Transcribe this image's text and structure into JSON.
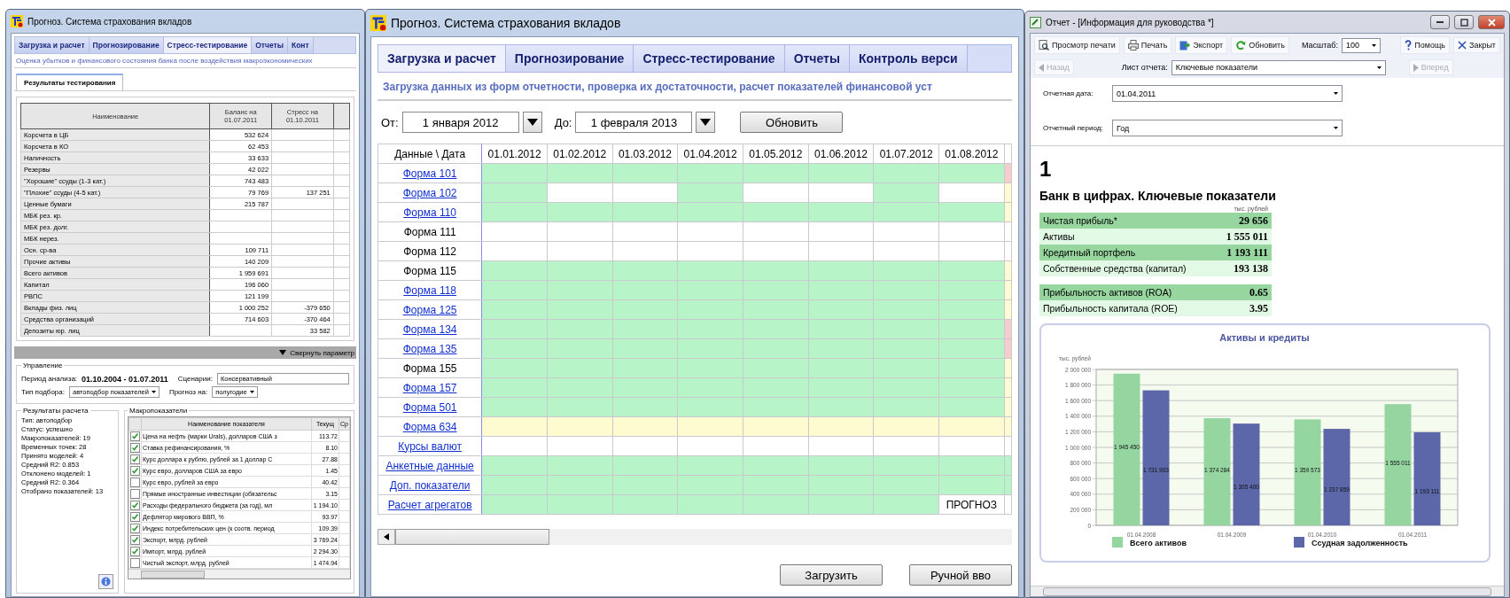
{
  "left_window": {
    "title": "Прогноз. Система страхования вкладов",
    "tabs": [
      {
        "label": "Загрузка и расчет",
        "selected": false
      },
      {
        "label": "Прогнозирование",
        "selected": false
      },
      {
        "label": "Стресс-тестирование",
        "selected": true
      },
      {
        "label": "Отчеты",
        "selected": false
      },
      {
        "label": "Конт",
        "selected": false
      }
    ],
    "subtitle": "Оценка убытков и финансового состояния банка после воздействия макроэкономических",
    "subtab": "Результаты тестирования",
    "table": {
      "columns": [
        "Наименование",
        "Баланс на 01.07.2011",
        "Стресс на 01.10.2011"
      ],
      "rows": [
        {
          "name": "Корсчета в ЦБ",
          "balance": "532 624"
        },
        {
          "name": "Корсчета в КО",
          "balance": "62 453"
        },
        {
          "name": "Наличность",
          "balance": "33 633"
        },
        {
          "name": "Резервы",
          "balance": "42 022"
        },
        {
          "name": "\"Хорошие\" ссуды (1-3 кат.)",
          "balance": "743 483"
        },
        {
          "name": "\"Плохие\" ссуды (4-5 кат.)",
          "balance": "79 769",
          "stress": "137 251"
        },
        {
          "name": "Ценные бумаги",
          "balance": "215 787"
        },
        {
          "name": "МБК рез. кр."
        },
        {
          "name": "МБК рез. долг."
        },
        {
          "name": "МБК нерез."
        },
        {
          "name": "Осн. ср-ва",
          "balance": "109 711"
        },
        {
          "name": "Прочие активы",
          "balance": "140 209"
        },
        {
          "name": "Всего активов",
          "balance": "1 959 691"
        },
        {
          "name": "Капитал",
          "balance": "196 060"
        },
        {
          "name": "РВПС",
          "balance": "121 199"
        },
        {
          "name": "Вклады физ. лиц",
          "balance": "1 000 252",
          "stress": "-379 650"
        },
        {
          "name": "Средства организаций",
          "balance": "714 603",
          "stress": "-370 464"
        },
        {
          "name": "Депозиты юр. лиц",
          "stress": "33 582"
        }
      ]
    },
    "collapse_label": "Свернуть параметр",
    "control": {
      "legend": "Управление",
      "period_label": "Период анализа:",
      "period_value": "01.10.2004 - 01.07.2011",
      "scenario_label": "Сценарии:",
      "scenario_value": "Консервативный",
      "selection_label": "Тип подбора:",
      "selection_value": "автоподбор показателей",
      "forecast_label": "Прогноз на:",
      "forecast_value": "полугодие"
    },
    "results": {
      "legend": "Результаты расчета",
      "lines": [
        "Тип: автоподбор",
        "Статус: успешно",
        "Макропоказателей: 19",
        "Временных точек: 28",
        "Принято моделей: 4",
        "Средний R2: 0.853",
        "Отклонено моделей: 1",
        "Средний R2: 0.364",
        "Отобрано показателей: 13"
      ]
    },
    "macro": {
      "legend": "Макропоказатели",
      "columns": [
        "Наименование показателя",
        "Текущ",
        "Ср"
      ],
      "rows": [
        {
          "name": "Цена на нефть (марки Urals), долларов США з",
          "checked": true,
          "current": "113.72"
        },
        {
          "name": "Ставка рефинансирования, %",
          "checked": true,
          "current": "8.10"
        },
        {
          "name": "Курс доллара к рублю, рублей за 1 доллар С",
          "checked": true,
          "current": "27.88"
        },
        {
          "name": "Курс евро, долларов США за евро",
          "checked": true,
          "current": "1.45"
        },
        {
          "name": "Курс евро, рублей за евро",
          "checked": false,
          "current": "40.42"
        },
        {
          "name": "Прямые иностранные инвестиции (обязательс",
          "checked": false,
          "current": "3.15"
        },
        {
          "name": "Расходы федерального бюджета (за год), мл",
          "checked": true,
          "current": "1 194.10"
        },
        {
          "name": "Дефлятор мирового ВВП, %",
          "checked": true,
          "current": "93.97"
        },
        {
          "name": "Индекс потребительских цен (к соотв. период",
          "checked": true,
          "current": "109.39"
        },
        {
          "name": "Экспорт, млрд. рублей",
          "checked": true,
          "current": "3 769.24"
        },
        {
          "name": "Импорт, млрд. рублей",
          "checked": true,
          "current": "2 294.30"
        },
        {
          "name": "Чистый экспорт, млрд. рублей",
          "checked": false,
          "current": "1 474.94"
        }
      ]
    }
  },
  "main_window": {
    "title": "Прогноз. Система страхования вкладов",
    "tabs": [
      {
        "label": "Загрузка и расчет",
        "selected": true
      },
      {
        "label": "Прогнозирование",
        "selected": false
      },
      {
        "label": "Стресс-тестирование",
        "selected": false
      },
      {
        "label": "Отчеты",
        "selected": false
      },
      {
        "label": "Контроль верси",
        "selected": false
      }
    ],
    "subtitle": "Загрузка данных из форм отчетности, проверка их достаточности, расчет показателей финансовой уст",
    "from_label": "От:",
    "from_value": "1 января 2012",
    "to_label": "До:",
    "to_value": "1 февраля 2013",
    "refresh_button": "Обновить",
    "grid": {
      "corner": "Данные \\ Дата",
      "dates": [
        "01.01.2012",
        "01.02.2012",
        "01.03.2012",
        "01.04.2012",
        "01.05.2012",
        "01.06.2012",
        "01.07.2012",
        "01.08.2012"
      ],
      "rows": [
        {
          "label": "Форма 101",
          "link": true,
          "cells": [
            {
              "color": "#b7f5c9"
            },
            {
              "color": "#b7f5c9"
            },
            {
              "color": "#b7f5c9"
            },
            {
              "color": "#b7f5c9"
            },
            {
              "color": "#b7f5c9"
            },
            {
              "color": "#b7f5c9"
            },
            {
              "color": "#b7f5c9"
            },
            {
              "color": "#b7f5c9"
            },
            {
              "color": "#f6cccd"
            }
          ]
        },
        {
          "label": "Форма 102",
          "link": true,
          "cells": [
            {
              "color": "#b7f5c9"
            },
            {
              "color": "#ffffff"
            },
            {
              "color": "#ffffff"
            },
            {
              "color": "#b7f5c9"
            },
            {
              "color": "#ffffff"
            },
            {
              "color": "#ffffff"
            },
            {
              "color": "#b7f5c9"
            },
            {
              "color": "#ffffff"
            },
            {
              "color": "#fffbd0"
            }
          ]
        },
        {
          "label": "Форма 110",
          "link": true,
          "cells": [
            {
              "color": "#b7f5c9"
            },
            {
              "color": "#b7f5c9"
            },
            {
              "color": "#b7f5c9"
            },
            {
              "color": "#b7f5c9"
            },
            {
              "color": "#b7f5c9"
            },
            {
              "color": "#b7f5c9"
            },
            {
              "color": "#b7f5c9"
            },
            {
              "color": "#b7f5c9"
            },
            {
              "color": "#fffbd0"
            }
          ]
        },
        {
          "label": "Форма 111",
          "link": false,
          "cells": [
            {
              "color": "#ffffff"
            },
            {
              "color": "#ffffff"
            },
            {
              "color": "#ffffff"
            },
            {
              "color": "#ffffff"
            },
            {
              "color": "#ffffff"
            },
            {
              "color": "#ffffff"
            },
            {
              "color": "#ffffff"
            },
            {
              "color": "#ffffff"
            },
            {
              "color": "#ffffff"
            }
          ]
        },
        {
          "label": "Форма 112",
          "link": false,
          "cells": [
            {
              "color": "#ffffff"
            },
            {
              "color": "#ffffff"
            },
            {
              "color": "#ffffff"
            },
            {
              "color": "#ffffff"
            },
            {
              "color": "#ffffff"
            },
            {
              "color": "#ffffff"
            },
            {
              "color": "#ffffff"
            },
            {
              "color": "#ffffff"
            },
            {
              "color": "#ffffff"
            }
          ]
        },
        {
          "label": "Форма 115",
          "link": false,
          "cells": [
            {
              "color": "#b7f5c9"
            },
            {
              "color": "#b7f5c9"
            },
            {
              "color": "#b7f5c9"
            },
            {
              "color": "#b7f5c9"
            },
            {
              "color": "#b7f5c9"
            },
            {
              "color": "#b7f5c9"
            },
            {
              "color": "#b7f5c9"
            },
            {
              "color": "#b7f5c9"
            },
            {
              "color": "#fffbd0"
            }
          ]
        },
        {
          "label": "Форма 118",
          "link": true,
          "cells": [
            {
              "color": "#b7f5c9"
            },
            {
              "color": "#b7f5c9"
            },
            {
              "color": "#b7f5c9"
            },
            {
              "color": "#b7f5c9"
            },
            {
              "color": "#b7f5c9"
            },
            {
              "color": "#b7f5c9"
            },
            {
              "color": "#b7f5c9"
            },
            {
              "color": "#b7f5c9"
            },
            {
              "color": "#fffbd0"
            }
          ]
        },
        {
          "label": "Форма 125",
          "link": true,
          "cells": [
            {
              "color": "#b7f5c9"
            },
            {
              "color": "#b7f5c9"
            },
            {
              "color": "#b7f5c9"
            },
            {
              "color": "#b7f5c9"
            },
            {
              "color": "#b7f5c9"
            },
            {
              "color": "#b7f5c9"
            },
            {
              "color": "#b7f5c9"
            },
            {
              "color": "#b7f5c9"
            },
            {
              "color": "#fffbd0"
            }
          ]
        },
        {
          "label": "Форма 134",
          "link": true,
          "cells": [
            {
              "color": "#b7f5c9"
            },
            {
              "color": "#b7f5c9"
            },
            {
              "color": "#b7f5c9"
            },
            {
              "color": "#b7f5c9"
            },
            {
              "color": "#b7f5c9"
            },
            {
              "color": "#b7f5c9"
            },
            {
              "color": "#b7f5c9"
            },
            {
              "color": "#b7f5c9"
            },
            {
              "color": "#f6cccd"
            }
          ]
        },
        {
          "label": "Форма 135",
          "link": true,
          "cells": [
            {
              "color": "#b7f5c9"
            },
            {
              "color": "#b7f5c9"
            },
            {
              "color": "#b7f5c9"
            },
            {
              "color": "#b7f5c9"
            },
            {
              "color": "#b7f5c9"
            },
            {
              "color": "#b7f5c9"
            },
            {
              "color": "#b7f5c9"
            },
            {
              "color": "#b7f5c9"
            },
            {
              "color": "#f6cccd"
            }
          ]
        },
        {
          "label": "Форма 155",
          "link": false,
          "cells": [
            {
              "color": "#b7f5c9"
            },
            {
              "color": "#b7f5c9"
            },
            {
              "color": "#b7f5c9"
            },
            {
              "color": "#b7f5c9"
            },
            {
              "color": "#b7f5c9"
            },
            {
              "color": "#b7f5c9"
            },
            {
              "color": "#b7f5c9"
            },
            {
              "color": "#b7f5c9"
            },
            {
              "color": "#fffbd0"
            }
          ]
        },
        {
          "label": "Форма 157",
          "link": true,
          "cells": [
            {
              "color": "#b7f5c9"
            },
            {
              "color": "#b7f5c9"
            },
            {
              "color": "#b7f5c9"
            },
            {
              "color": "#b7f5c9"
            },
            {
              "color": "#b7f5c9"
            },
            {
              "color": "#b7f5c9"
            },
            {
              "color": "#b7f5c9"
            },
            {
              "color": "#b7f5c9"
            },
            {
              "color": "#fffbd0"
            }
          ]
        },
        {
          "label": "Форма 501",
          "link": true,
          "cells": [
            {
              "color": "#b7f5c9"
            },
            {
              "color": "#b7f5c9"
            },
            {
              "color": "#b7f5c9"
            },
            {
              "color": "#b7f5c9"
            },
            {
              "color": "#b7f5c9"
            },
            {
              "color": "#b7f5c9"
            },
            {
              "color": "#b7f5c9"
            },
            {
              "color": "#b7f5c9"
            },
            {
              "color": "#fffbd0"
            }
          ]
        },
        {
          "label": "Форма 634",
          "link": true,
          "cells": [
            {
              "color": "#fffbd0"
            },
            {
              "color": "#fffbd0"
            },
            {
              "color": "#fffbd0"
            },
            {
              "color": "#fffbd0"
            },
            {
              "color": "#fffbd0"
            },
            {
              "color": "#fffbd0"
            },
            {
              "color": "#fffbd0"
            },
            {
              "color": "#fffbd0"
            },
            {
              "color": "#fffbd0"
            }
          ]
        },
        {
          "label": "Курсы валют",
          "link": true,
          "cells": [
            {
              "color": "#ffffff"
            },
            {
              "color": "#ffffff"
            },
            {
              "color": "#ffffff"
            },
            {
              "color": "#ffffff"
            },
            {
              "color": "#ffffff"
            },
            {
              "color": "#ffffff"
            },
            {
              "color": "#ffffff"
            },
            {
              "color": "#ffffff"
            },
            {
              "color": "#ffffff"
            }
          ]
        },
        {
          "label": "Анкетные данные",
          "link": true,
          "cells": [
            {
              "color": "#b7f5c9"
            },
            {
              "color": "#b7f5c9"
            },
            {
              "color": "#b7f5c9"
            },
            {
              "color": "#b7f5c9"
            },
            {
              "color": "#b7f5c9"
            },
            {
              "color": "#b7f5c9"
            },
            {
              "color": "#b7f5c9"
            },
            {
              "color": "#b7f5c9"
            },
            {
              "color": "#b7f5c9"
            }
          ]
        },
        {
          "label": "Доп. показатели",
          "link": true,
          "cells": [
            {
              "color": "#b7f5c9"
            },
            {
              "color": "#b7f5c9"
            },
            {
              "color": "#b7f5c9"
            },
            {
              "color": "#b7f5c9"
            },
            {
              "color": "#b7f5c9"
            },
            {
              "color": "#b7f5c9"
            },
            {
              "color": "#b7f5c9"
            },
            {
              "color": "#b7f5c9"
            },
            {
              "color": "#b7f5c9"
            }
          ]
        },
        {
          "label": "Расчет агрегатов",
          "link": true,
          "cells": [
            {
              "color": "#b7f5c9"
            },
            {
              "color": "#b7f5c9"
            },
            {
              "color": "#b7f5c9"
            },
            {
              "color": "#b7f5c9"
            },
            {
              "color": "#b7f5c9"
            },
            {
              "color": "#b7f5c9"
            },
            {
              "color": "#b7f5c9"
            },
            {
              "color": "#ffffff",
              "text": "ПРОГНОЗ"
            },
            {
              "color": "#ffffff"
            }
          ]
        }
      ]
    },
    "buttons": [
      "Загрузить",
      "Ручной вво"
    ]
  },
  "report_window": {
    "title": "Отчет - [Информация для руководства *]",
    "toolbar": {
      "print_preview": "Просмотр печати",
      "print": "Печать",
      "export": "Экспорт",
      "refresh": "Обновить",
      "zoom_label": "Масштаб:",
      "zoom_value": "100",
      "help": "Помощь",
      "close": "Закрыт"
    },
    "nav": {
      "back": {
        "label": "Назад",
        "disabled": true
      },
      "sheet_label": "Лист отчета:",
      "sheet_value": "Ключевые показатели",
      "forward": {
        "label": "Вперед",
        "disabled": true
      }
    },
    "date_label": "Отчетная дата:",
    "date_value": "01.04.2011",
    "period_label": "Отчетный период:",
    "period_value": "Год",
    "page_number": "1",
    "heading": "Банк в цифрах. Ключевые показатели",
    "unit": "тыс. рублей",
    "key_figures": [
      {
        "label": "Чистая прибыль*",
        "value": "29 656"
      },
      {
        "label": "Активы",
        "value": "1 555 011"
      },
      {
        "label": "Кредитный портфель",
        "value": "1 193 111"
      },
      {
        "label": "Собственные средства (капитал)",
        "value": "193 138"
      }
    ],
    "ratios": [
      {
        "label": "Прибыльность активов (ROA)",
        "value": "0.65"
      },
      {
        "label": "Прибыльность капитала (ROE)",
        "value": "3.95"
      }
    ],
    "chart": {
      "chart_data": {
        "type": "bar",
        "title": "Активы и кредиты",
        "ylabel": "тыс. рублей",
        "categories": [
          "01.04.2008",
          "01.04.2009",
          "01.04.2010",
          "01.04.2011"
        ],
        "series": [
          {
            "name": "Всего активов",
            "color": "#95d5a0",
            "values": [
              1945450,
              1374284,
              1359573,
              1555011
            ]
          },
          {
            "name": "Ссудная задолженность",
            "color": "#5b67a8",
            "values": [
              1731903,
              1305400,
              1237859,
              1193111
            ]
          }
        ],
        "ylim": [
          0,
          2000000
        ],
        "yticks": [
          {
            "value": 0,
            "label": "0"
          },
          {
            "value": 200000,
            "label": "200 000"
          },
          {
            "value": 400000,
            "label": "400 000"
          },
          {
            "value": 600000,
            "label": "600 000"
          },
          {
            "value": 800000,
            "label": "800 000"
          },
          {
            "value": 1000000,
            "label": "1 000 000"
          },
          {
            "value": 1200000,
            "label": "1 200 000"
          },
          {
            "value": 1400000,
            "label": "1 400 000"
          },
          {
            "value": 1600000,
            "label": "1 600 000"
          },
          {
            "value": 1800000,
            "label": "1 800 000"
          },
          {
            "value": 2000000,
            "label": "2 000 000"
          }
        ],
        "grid": true,
        "legend": true,
        "value_labels": [
          [
            "1 945 450",
            "1 374 284",
            "1 359 573",
            "1 555 011"
          ],
          [
            "1 731 903",
            "1 305 400",
            "1 237 859",
            "1 193 111"
          ]
        ]
      }
    }
  }
}
